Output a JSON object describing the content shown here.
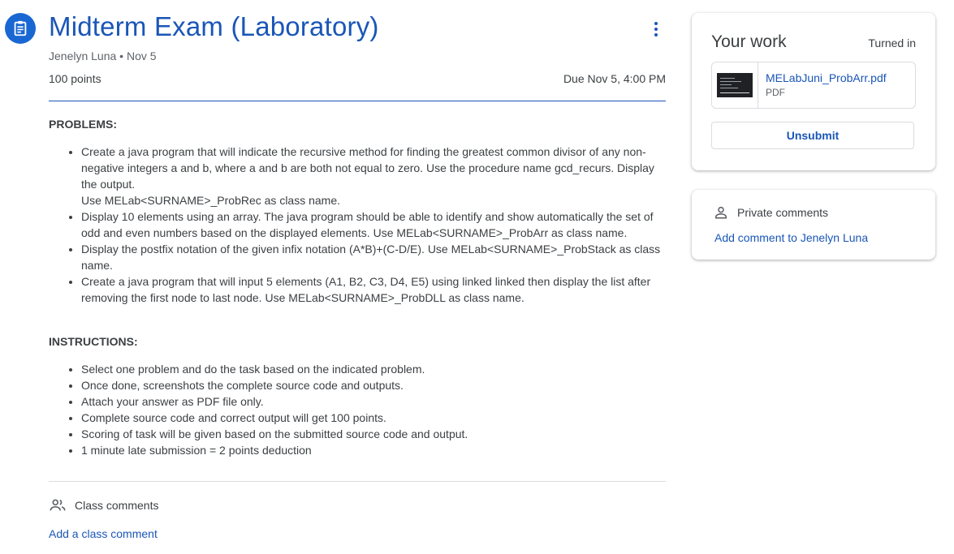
{
  "assignment": {
    "title": "Midterm Exam (Laboratory)",
    "meta": "Jenelyn Luna • Nov 5",
    "points": "100 points",
    "due": "Due Nov 5, 4:00 PM"
  },
  "problems": {
    "heading": "PROBLEMS:",
    "items": [
      {
        "line1": "Create a java program that will indicate the recursive method for finding the greatest common divisor of any non-negative integers a and b, where a and b are both not equal to zero. Use the procedure name gcd_recurs. Display the output.",
        "line2": "Use  MELab<SURNAME>_ProbRec as class name."
      },
      {
        "line1": "Display 10 elements using an array. The java program should be able to identify and show automatically the set of odd and even numbers based on the displayed elements. Use  MELab<SURNAME>_ProbArr as class name."
      },
      {
        "line1": "Display the postfix notation of the given infix notation (A*B)+(C-D/E). Use  MELab<SURNAME>_ProbStack as class name."
      },
      {
        "line1": "Create a java program that will input 5 elements (A1, B2, C3, D4, E5) using linked linked then display the list after removing the first node to last node. Use  MELab<SURNAME>_ProbDLL as class name."
      }
    ]
  },
  "instructions": {
    "heading": "INSTRUCTIONS:",
    "items": [
      "Select one problem and do the task based on the indicated problem.",
      "Once done, screenshots the complete source code and outputs.",
      "Attach your answer as PDF file only.",
      "Complete source code and correct output will get 100 points.",
      "Scoring of task will be given based on the submitted source code and output.",
      "1 minute late submission = 2 points deduction"
    ]
  },
  "comments": {
    "class_label": "Class comments",
    "add_class": "Add a class comment"
  },
  "your_work": {
    "title": "Your work",
    "status": "Turned in",
    "attachment_name": "MELabJuni_ProbArr.pdf",
    "attachment_type": "PDF",
    "unsubmit_label": "Unsubmit"
  },
  "private_comments": {
    "label": "Private comments",
    "add": "Add comment to Jenelyn Luna"
  },
  "colors": {
    "accent": "#1a56b7",
    "icon_bg": "#1967d2",
    "text": "#3c4043",
    "muted": "#5f6368",
    "border": "#dadce0"
  }
}
